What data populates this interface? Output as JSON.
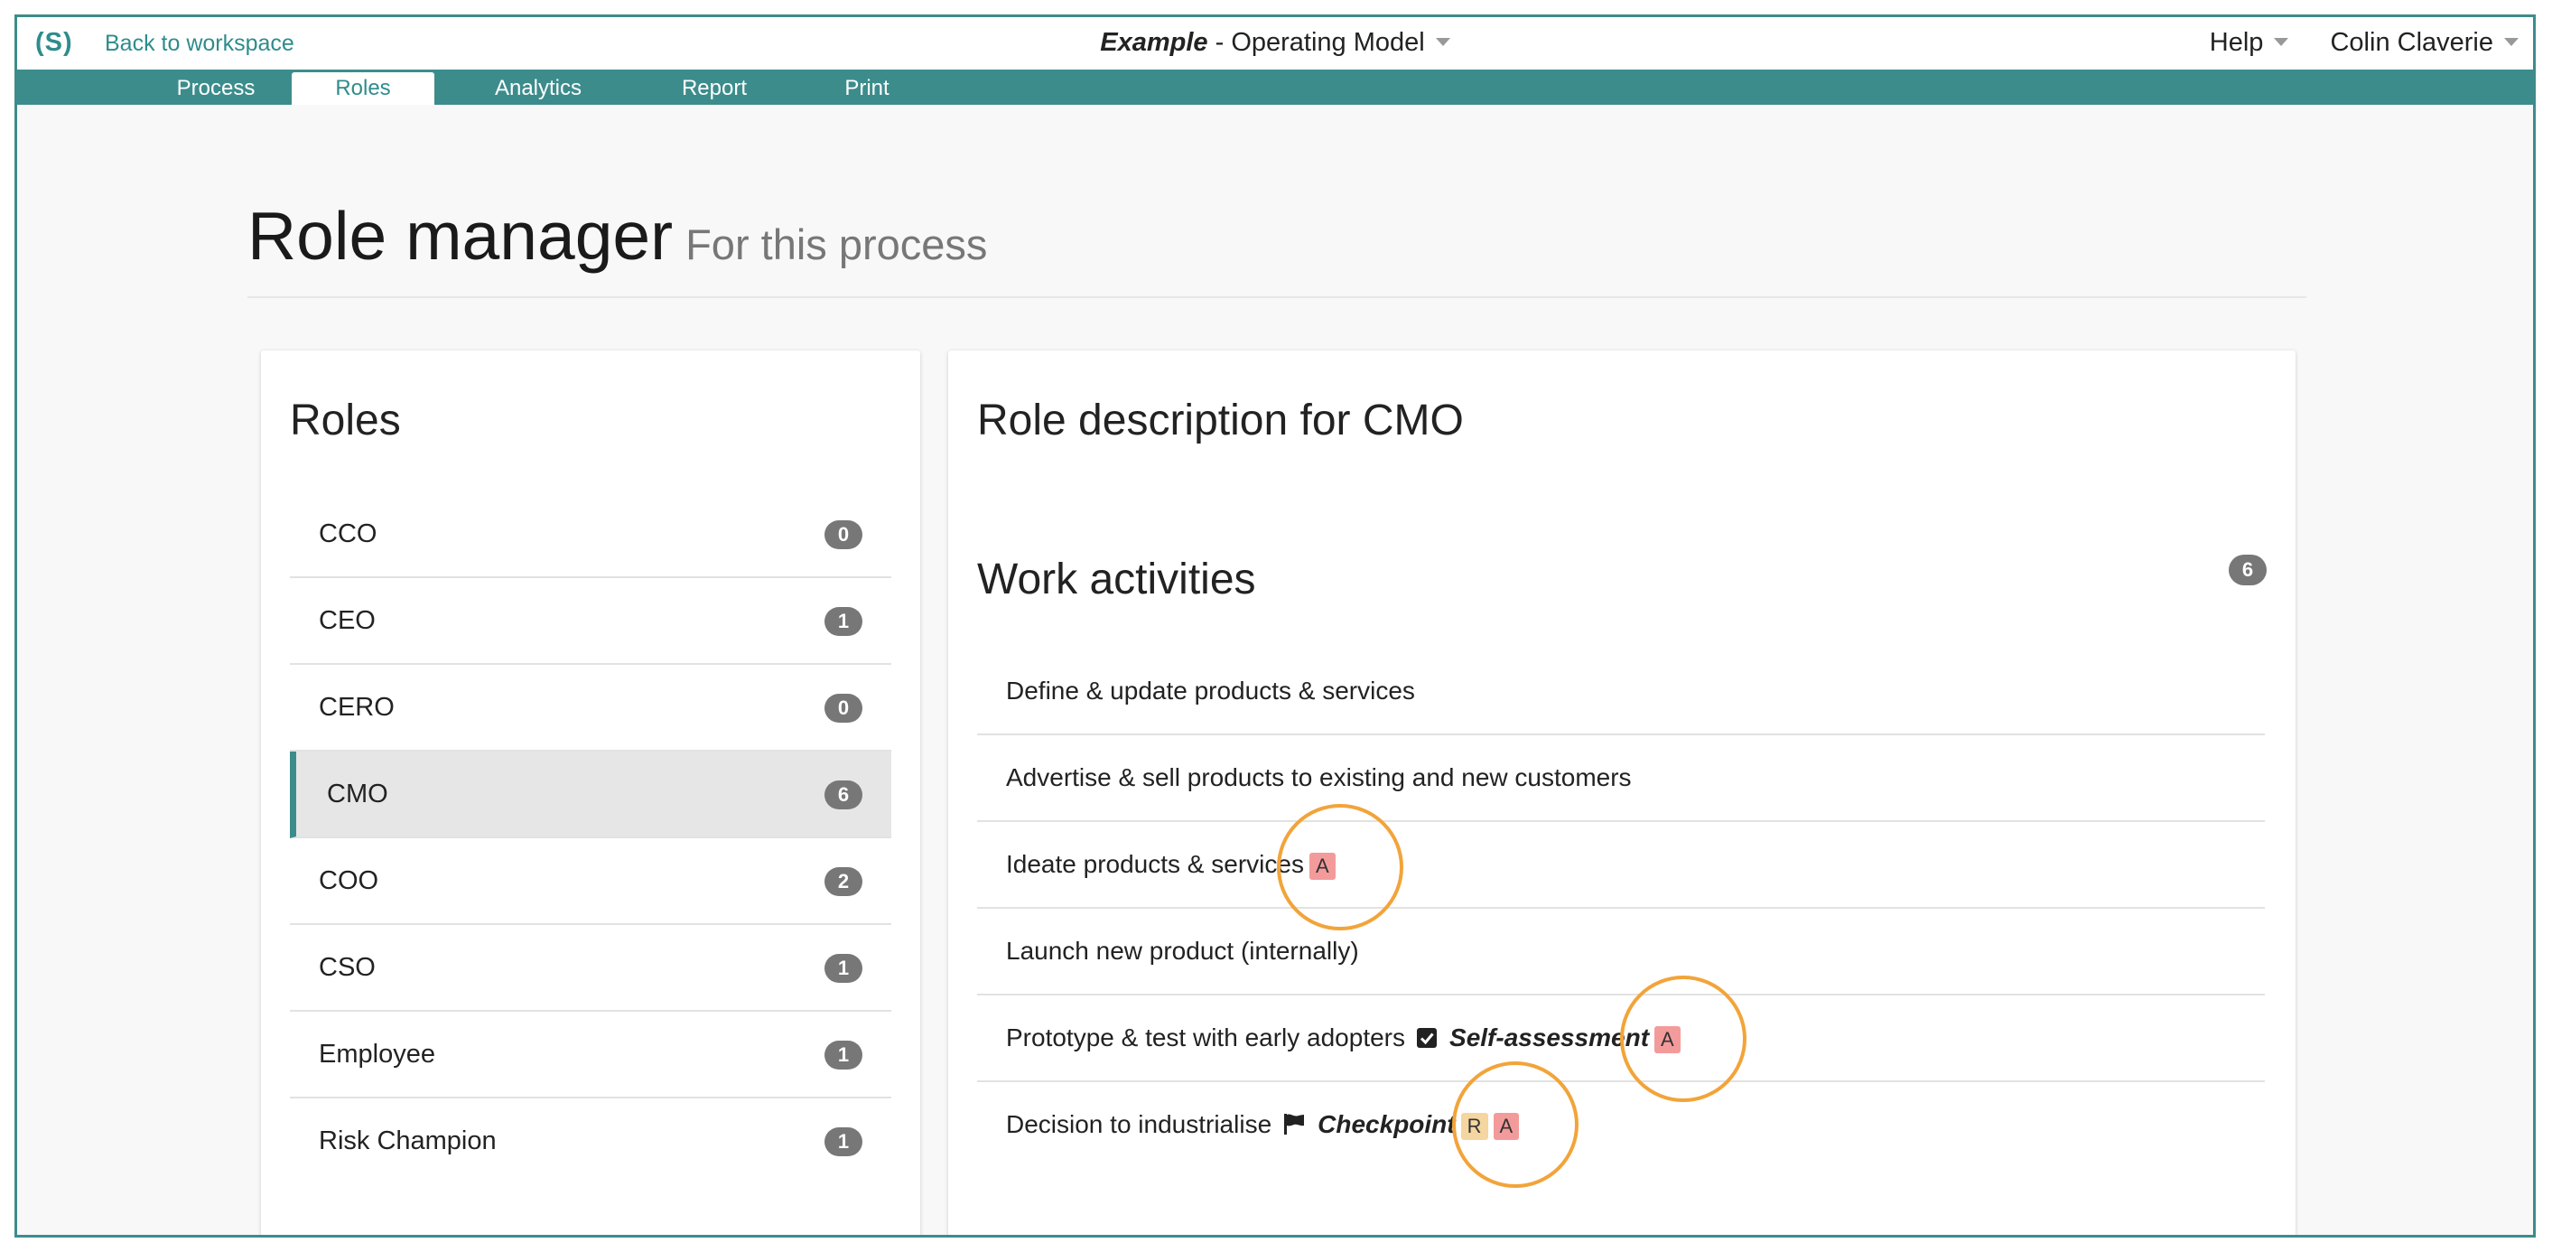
{
  "topbar": {
    "logo": "(S)",
    "back_link": "Back to workspace",
    "title_name": "Example",
    "title_rest": " - Operating Model",
    "help": "Help",
    "user": "Colin Claverie"
  },
  "nav": {
    "tabs": [
      {
        "label": "Process"
      },
      {
        "label": "Roles"
      },
      {
        "label": "Analytics"
      },
      {
        "label": "Report"
      },
      {
        "label": "Print"
      }
    ],
    "active_tab": "Roles"
  },
  "page": {
    "title": "Role manager",
    "subtitle": "For this process"
  },
  "roles_panel": {
    "heading": "Roles",
    "items": [
      {
        "name": "CCO",
        "count": "0"
      },
      {
        "name": "CEO",
        "count": "1"
      },
      {
        "name": "CERO",
        "count": "0"
      },
      {
        "name": "CMO",
        "count": "6"
      },
      {
        "name": "COO",
        "count": "2"
      },
      {
        "name": "CSO",
        "count": "1"
      },
      {
        "name": "Employee",
        "count": "1"
      },
      {
        "name": "Risk Champion",
        "count": "1"
      }
    ],
    "selected": "CMO"
  },
  "role_panel": {
    "heading": "Role description for CMO",
    "activities_heading": "Work activities",
    "activities_count": "6",
    "activities": [
      {
        "text": "Define & update products & services"
      },
      {
        "text": "Advertise & sell products to existing and new customers"
      },
      {
        "text": "Ideate products & services",
        "raci": [
          "A"
        ]
      },
      {
        "text": "Launch new product (internally)"
      },
      {
        "text": "Prototype & test with early adopters",
        "gate_icon": "check-square-icon",
        "gate": "Self-assessment",
        "raci": [
          "A"
        ]
      },
      {
        "text": "Decision to industrialise",
        "gate_icon": "flag-icon",
        "gate": "Checkpoint",
        "raci": [
          "R",
          "A"
        ]
      }
    ]
  },
  "colors": {
    "accent": "#3d8c8c",
    "raci_a": "#f39b9b",
    "raci_r": "#f5d5a0",
    "highlight": "#f2a43a"
  }
}
